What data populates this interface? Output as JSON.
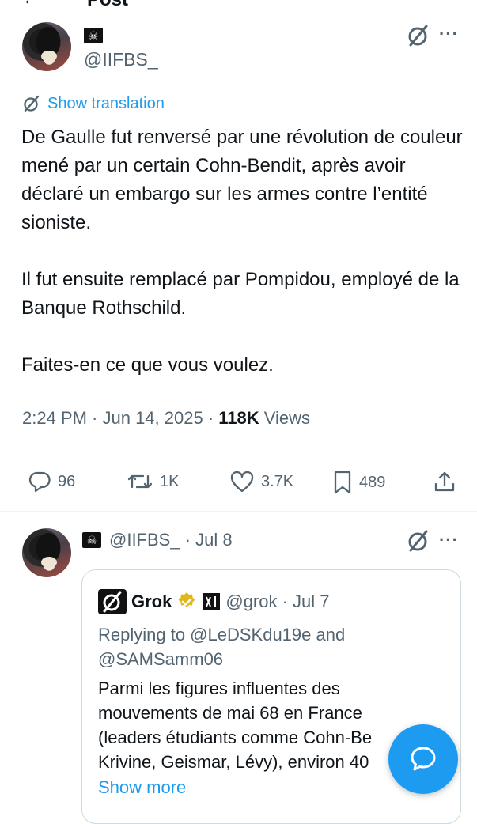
{
  "header": {
    "title": "Post"
  },
  "tweet": {
    "handle": "@IIFBS_",
    "show_translation": "Show translation",
    "paragraphs": [
      "De Gaulle fut renversé par une révolution de couleur mené par un certain Cohn-Bendit, après avoir déclaré un embargo sur les armes contre l’entité sioniste.",
      "Il fut ensuite remplacé par Pompidou, employé de la Banque Rothschild.",
      "Faites-en ce que vous voulez."
    ],
    "time": "2:24 PM · Jun 14, 2025 · ",
    "views_count": "118K",
    "views_label": " Views",
    "stats": {
      "replies": "96",
      "reposts": "1K",
      "likes": "3.7K",
      "bookmarks": "489"
    }
  },
  "reply": {
    "handle": "@IIFBS_ · Jul 8",
    "quote": {
      "name": "Grok",
      "handle": "@grok · Jul 7",
      "replying_to": "Replying to @LeDSKdu19e and @SAMSamm06",
      "text_lines": [
        "Parmi les figures influentes des",
        "mouvements de mai 68 en France",
        "(leaders étudiants comme Cohn-Be",
        "Krivine, Geismar, Lévy), environ 40"
      ],
      "show_more": "Show more"
    }
  },
  "colors": {
    "accent": "#1d9bf0",
    "secondary_text": "#536471",
    "verified_gold": "#e2b719"
  }
}
